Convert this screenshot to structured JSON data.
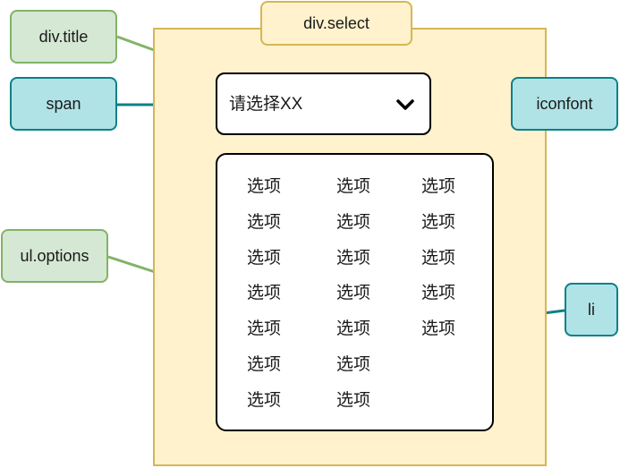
{
  "labels": {
    "div_select": "div.select",
    "div_title": "div.title",
    "span": "span",
    "iconfont": "iconfont",
    "ul_options": "ul.options",
    "li": "li"
  },
  "select": {
    "placeholder": "请选择XX",
    "icon": "chevron-down-icon"
  },
  "options": {
    "columns": [
      [
        "选项",
        "选项",
        "选项",
        "选项",
        "选项",
        "选项",
        "选项"
      ],
      [
        "选项",
        "选项",
        "选项",
        "选项",
        "选项",
        "选项",
        "选项"
      ],
      [
        "选项",
        "选项",
        "选项",
        "选项",
        "选项"
      ]
    ]
  },
  "colors": {
    "container_fill": "#fff2cc",
    "container_stroke": "#d6b656",
    "green_fill": "#d5e8d4",
    "green_stroke": "#82b366",
    "teal_fill": "#b0e3e6",
    "teal_stroke": "#0e8088"
  }
}
